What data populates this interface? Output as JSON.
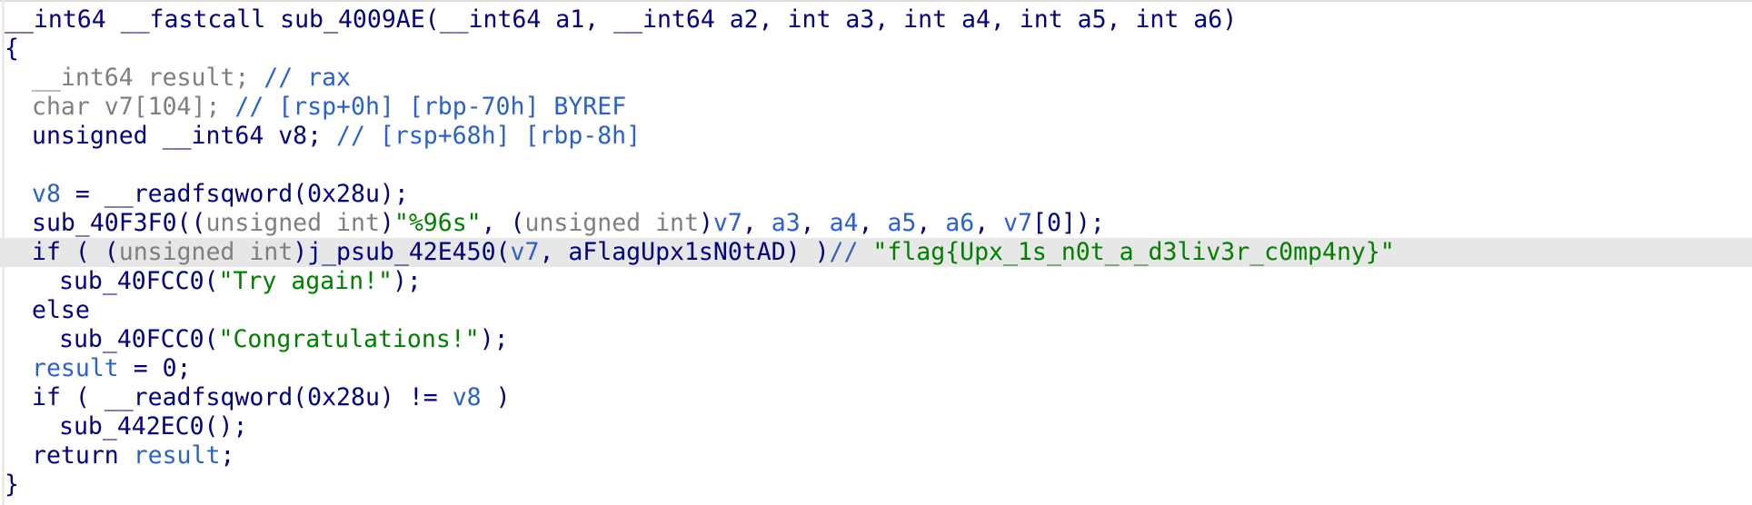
{
  "editor": {
    "lines": [
      {
        "indent": 0,
        "highlight": false,
        "tokens": [
          {
            "t": "__int64 __fastcall sub_4009AE(",
            "c": "plain"
          },
          {
            "t": "__int64 a1, __int64 a2, int a3, int a4, int a5, int a6",
            "c": "plain"
          },
          {
            "t": ")",
            "c": "plain"
          }
        ]
      },
      {
        "indent": 0,
        "highlight": false,
        "tokens": [
          {
            "t": "{",
            "c": "plain"
          }
        ]
      },
      {
        "indent": 1,
        "highlight": false,
        "tokens": [
          {
            "t": "__int64 result; ",
            "c": "grey"
          },
          {
            "t": "// rax",
            "c": "comment"
          }
        ]
      },
      {
        "indent": 1,
        "highlight": false,
        "tokens": [
          {
            "t": "char v7[104]; ",
            "c": "grey"
          },
          {
            "t": "// [rsp+0h] [rbp-70h] BYREF",
            "c": "comment"
          }
        ]
      },
      {
        "indent": 1,
        "highlight": false,
        "tokens": [
          {
            "t": "unsigned __int64 v8; ",
            "c": "plain"
          },
          {
            "t": "// [rsp+68h] [rbp-8h]",
            "c": "comment"
          }
        ]
      },
      {
        "indent": 0,
        "highlight": false,
        "tokens": []
      },
      {
        "indent": 1,
        "highlight": false,
        "tokens": [
          {
            "t": "v8",
            "c": "arg"
          },
          {
            "t": " = __readfsqword(0x28u);",
            "c": "plain"
          }
        ]
      },
      {
        "indent": 1,
        "highlight": false,
        "tokens": [
          {
            "t": "sub_40F3F0((",
            "c": "plain"
          },
          {
            "t": "unsigned int",
            "c": "grey"
          },
          {
            "t": ")",
            "c": "plain"
          },
          {
            "t": "\"%96s\"",
            "c": "str"
          },
          {
            "t": ", (",
            "c": "plain"
          },
          {
            "t": "unsigned int",
            "c": "grey"
          },
          {
            "t": ")",
            "c": "plain"
          },
          {
            "t": "v7",
            "c": "arg"
          },
          {
            "t": ", ",
            "c": "plain"
          },
          {
            "t": "a3",
            "c": "arg"
          },
          {
            "t": ", ",
            "c": "plain"
          },
          {
            "t": "a4",
            "c": "arg"
          },
          {
            "t": ", ",
            "c": "plain"
          },
          {
            "t": "a5",
            "c": "arg"
          },
          {
            "t": ", ",
            "c": "plain"
          },
          {
            "t": "a6",
            "c": "arg"
          },
          {
            "t": ", ",
            "c": "plain"
          },
          {
            "t": "v7",
            "c": "arg"
          },
          {
            "t": "[0]);",
            "c": "plain"
          }
        ]
      },
      {
        "indent": 1,
        "highlight": true,
        "tokens": [
          {
            "t": "if ( (",
            "c": "plain"
          },
          {
            "t": "unsigned int",
            "c": "grey"
          },
          {
            "t": ")j_psub_42E450(",
            "c": "plain"
          },
          {
            "t": "v7",
            "c": "arg"
          },
          {
            "t": ", aFlagUpx1sN0tAD) )",
            "c": "plain"
          },
          {
            "t": "// ",
            "c": "comment"
          },
          {
            "t": "\"flag{Upx_1s_n0t_a_d3liv3r_c0mp4ny}\"",
            "c": "str"
          }
        ]
      },
      {
        "indent": 2,
        "highlight": false,
        "tokens": [
          {
            "t": "sub_40FCC0(",
            "c": "plain"
          },
          {
            "t": "\"Try again!\"",
            "c": "str"
          },
          {
            "t": ");",
            "c": "plain"
          }
        ]
      },
      {
        "indent": 1,
        "highlight": false,
        "tokens": [
          {
            "t": "else",
            "c": "plain"
          }
        ]
      },
      {
        "indent": 2,
        "highlight": false,
        "tokens": [
          {
            "t": "sub_40FCC0(",
            "c": "plain"
          },
          {
            "t": "\"Congratulations!\"",
            "c": "str"
          },
          {
            "t": ");",
            "c": "plain"
          }
        ]
      },
      {
        "indent": 1,
        "highlight": false,
        "tokens": [
          {
            "t": "result",
            "c": "arg"
          },
          {
            "t": " = 0;",
            "c": "plain"
          }
        ]
      },
      {
        "indent": 1,
        "highlight": false,
        "tokens": [
          {
            "t": "if ( __readfsqword(0x28u) != ",
            "c": "plain"
          },
          {
            "t": "v8",
            "c": "arg"
          },
          {
            "t": " )",
            "c": "plain"
          }
        ]
      },
      {
        "indent": 2,
        "highlight": false,
        "tokens": [
          {
            "t": "sub_442EC0();",
            "c": "plain"
          }
        ]
      },
      {
        "indent": 1,
        "highlight": false,
        "tokens": [
          {
            "t": "return ",
            "c": "plain"
          },
          {
            "t": "result",
            "c": "arg"
          },
          {
            "t": ";",
            "c": "plain"
          }
        ]
      },
      {
        "indent": 0,
        "highlight": false,
        "tokens": [
          {
            "t": "}",
            "c": "plain"
          }
        ]
      }
    ]
  },
  "colors": {
    "plain": "#000080",
    "arg": "#2b62c8",
    "grey": "#7f7f7f",
    "str": "#008000",
    "comment": "#2b62c8",
    "highlight_bg": "#e7e7e7"
  }
}
